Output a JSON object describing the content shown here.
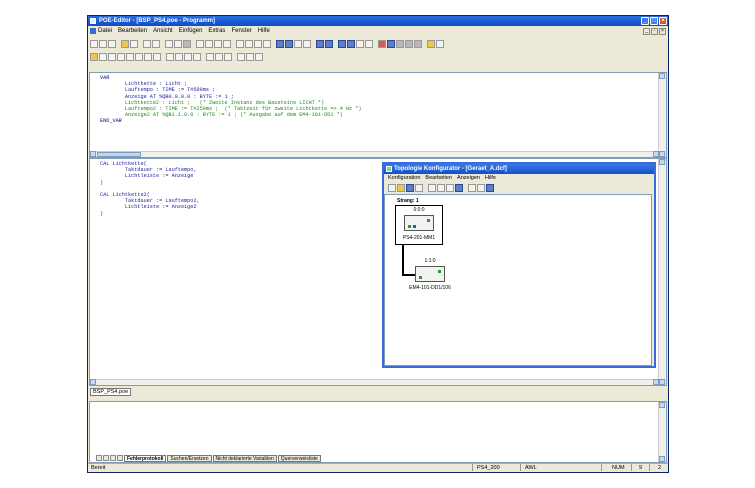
{
  "window": {
    "title": "POE-Editor - [BSP_PS4.poe - Programm]"
  },
  "menu": [
    "Datei",
    "Bearbeiten",
    "Ansicht",
    "Einfügen",
    "Extras",
    "Fenster",
    "Hilfe"
  ],
  "declaration_code": [
    {
      "text": "VAR",
      "cls": "k"
    },
    {
      "text": "        Lichtkette : Licht ;",
      "cls": ""
    },
    {
      "text": "        Lauftempo : TIME := T#500ms ;",
      "cls": ""
    },
    {
      "text": "        Anzeige AT %QB0.0.0.0 : BYTE := 1 ;",
      "cls": ""
    },
    {
      "text": "        Lichtkette2 : Licht ;   (* Zweite Instanz des Bausteins LICHT *)",
      "cls": "c"
    },
    {
      "text": "        Lauftempo2 : TIME := T#250ms ;  (* Taktzeit für zweite Lichtkette => 4 Hz *)",
      "cls": "c"
    },
    {
      "text": "        Anzeige2 AT %QB1.1.0.0 : BYTE := 1 ; (* Ausgabe auf dem EM4-101-DD1 *)",
      "cls": "c"
    },
    {
      "text": "END_VAR",
      "cls": "k"
    }
  ],
  "instruction_code": [
    "CAL Lichtkette(",
    "        Taktdauer := Lauftempo,",
    "        Lichtleiste := Anzeige",
    ")",
    "",
    "CAL Lichtkette2(",
    "        Taktdauer := Lauftempo2,",
    "        Lichtleiste := Anzeige2",
    ")"
  ],
  "topology": {
    "title": "Topologie Konfigurator - [Geraet_A.dcf]",
    "menu": [
      "Konfiguration",
      "Bearbeiten",
      "Anzeigen",
      "Hilfe"
    ],
    "strang": "Strang: 1",
    "module1": {
      "address": "0:0:0",
      "name": "PS4-201-MM1"
    },
    "module2": {
      "address": "1:1:0",
      "name": "EM4-101-DD1/106"
    }
  },
  "document_tab": "BSP_PS4.poe",
  "output_tabs": [
    "Fehlerprotokoll",
    "Suchen/Ersetzen",
    "Nicht deklarierte Variablen",
    "Querverweisliste"
  ],
  "status": {
    "left": "Bereit",
    "file": "PS4_200",
    "lang": "AWL",
    "num": "NUM",
    "line": "9",
    "col": "2"
  }
}
